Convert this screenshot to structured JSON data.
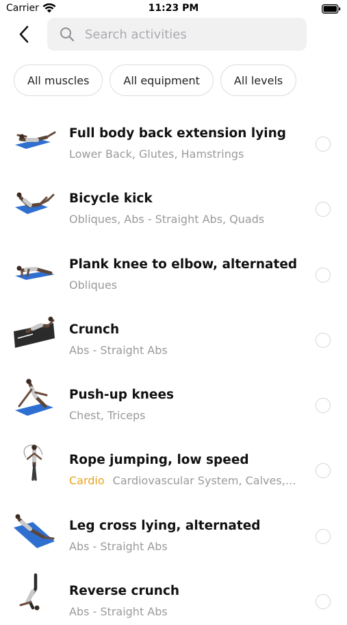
{
  "status_bar": {
    "carrier": "Carrier",
    "time": "11:23 PM"
  },
  "header": {
    "back_icon": "chevron-left-icon",
    "search": {
      "icon": "search-icon",
      "placeholder": "Search activities",
      "value": ""
    }
  },
  "filters": [
    {
      "label": "All muscles"
    },
    {
      "label": "All equipment"
    },
    {
      "label": "All levels"
    }
  ],
  "exercises": [
    {
      "title": "Full body back extension lying",
      "tag": "",
      "muscles": "Lower Back, Glutes, Hamstrings",
      "selected": false
    },
    {
      "title": "Bicycle kick",
      "tag": "",
      "muscles": "Obliques, Abs - Straight Abs, Quads",
      "selected": false
    },
    {
      "title": "Plank knee to elbow, alternated",
      "tag": "",
      "muscles": "Obliques",
      "selected": false
    },
    {
      "title": "Crunch",
      "tag": "",
      "muscles": "Abs - Straight Abs",
      "selected": false
    },
    {
      "title": "Push-up knees",
      "tag": "",
      "muscles": "Chest, Triceps",
      "selected": false
    },
    {
      "title": "Rope jumping, low speed",
      "tag": "Cardio",
      "muscles": "Cardiovascular System, Calves, F...",
      "selected": false
    },
    {
      "title": "Leg cross lying, alternated",
      "tag": "",
      "muscles": "Abs - Straight Abs",
      "selected": false
    },
    {
      "title": "Reverse crunch",
      "tag": "",
      "muscles": "Abs - Straight Abs",
      "selected": false
    }
  ],
  "colors": {
    "accent_tag": "#e8a31c",
    "mat": "#2f6fd0",
    "muted_text": "#9a9a9a"
  }
}
